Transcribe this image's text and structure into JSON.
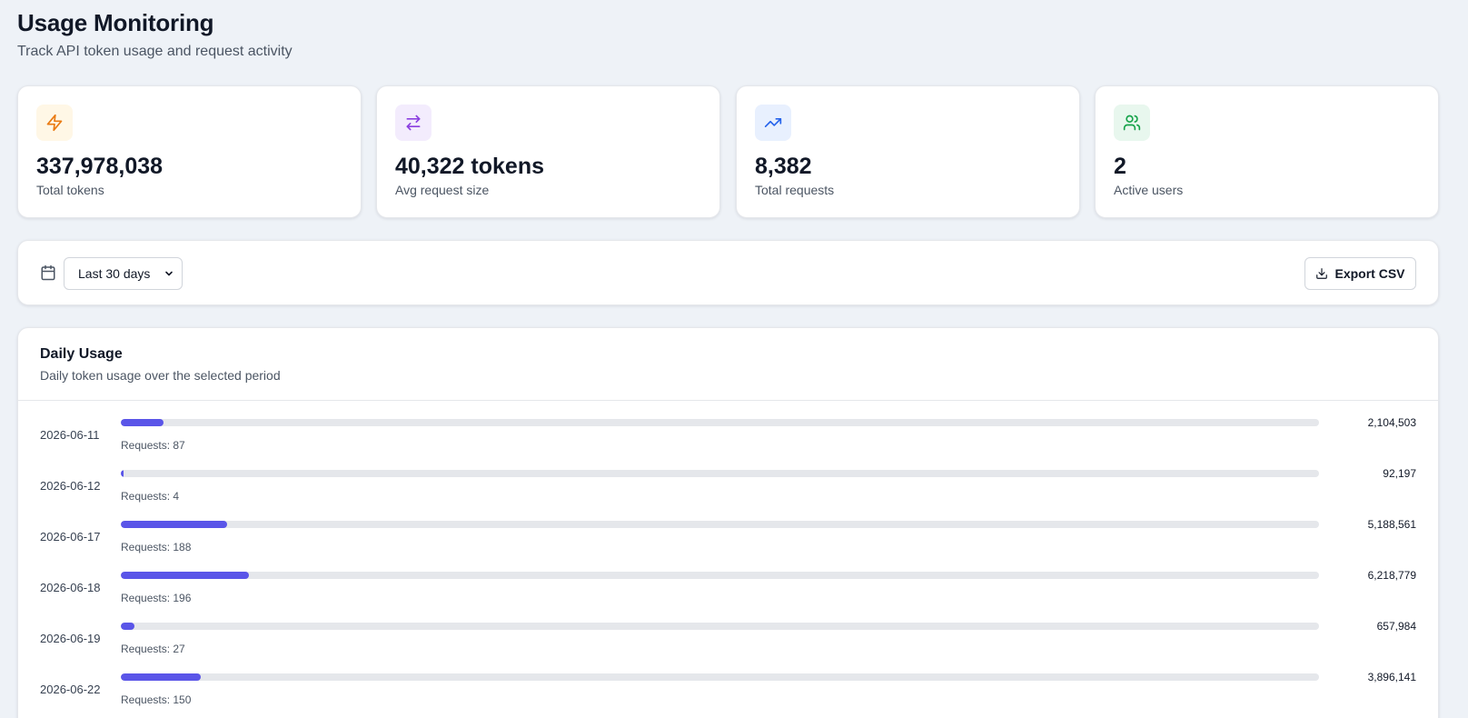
{
  "header": {
    "title": "Usage Monitoring",
    "subtitle": "Track API token usage and request activity"
  },
  "stats": [
    {
      "icon": "lightning-icon",
      "value": "337,978,038",
      "label": "Total tokens",
      "color": "#ea7a12",
      "bg": "#fff7e6"
    },
    {
      "icon": "arrows-exchange-icon",
      "value": "40,322 tokens",
      "label": "Avg request size",
      "color": "#8b3fe0",
      "bg": "#f3ecfd"
    },
    {
      "icon": "trending-up-icon",
      "value": "8,382",
      "label": "Total requests",
      "color": "#2563eb",
      "bg": "#e8f0fe"
    },
    {
      "icon": "users-icon",
      "value": "2",
      "label": "Active users",
      "color": "#16a34a",
      "bg": "#e8f7ee"
    }
  ],
  "filters": {
    "period_selected": "Last 30 days",
    "export_label": "Export CSV"
  },
  "daily_usage": {
    "title": "Daily Usage",
    "subtitle": "Daily token usage over the selected period",
    "rows": [
      {
        "date": "2026-06-11",
        "requests": "Requests: 87",
        "tokens": "2,104,503",
        "fill": 0.036
      },
      {
        "date": "2026-06-12",
        "requests": "Requests: 4",
        "tokens": "92,197",
        "fill": 0.002
      },
      {
        "date": "2026-06-17",
        "requests": "Requests: 188",
        "tokens": "5,188,561",
        "fill": 0.089
      },
      {
        "date": "2026-06-18",
        "requests": "Requests: 196",
        "tokens": "6,218,779",
        "fill": 0.107
      },
      {
        "date": "2026-06-19",
        "requests": "Requests: 27",
        "tokens": "657,984",
        "fill": 0.011
      },
      {
        "date": "2026-06-22",
        "requests": "Requests: 150",
        "tokens": "3,896,141",
        "fill": 0.067
      }
    ]
  },
  "colors": {
    "bar": "#5a55e8",
    "track": "#e5e7eb",
    "background": "#eef2f7"
  }
}
